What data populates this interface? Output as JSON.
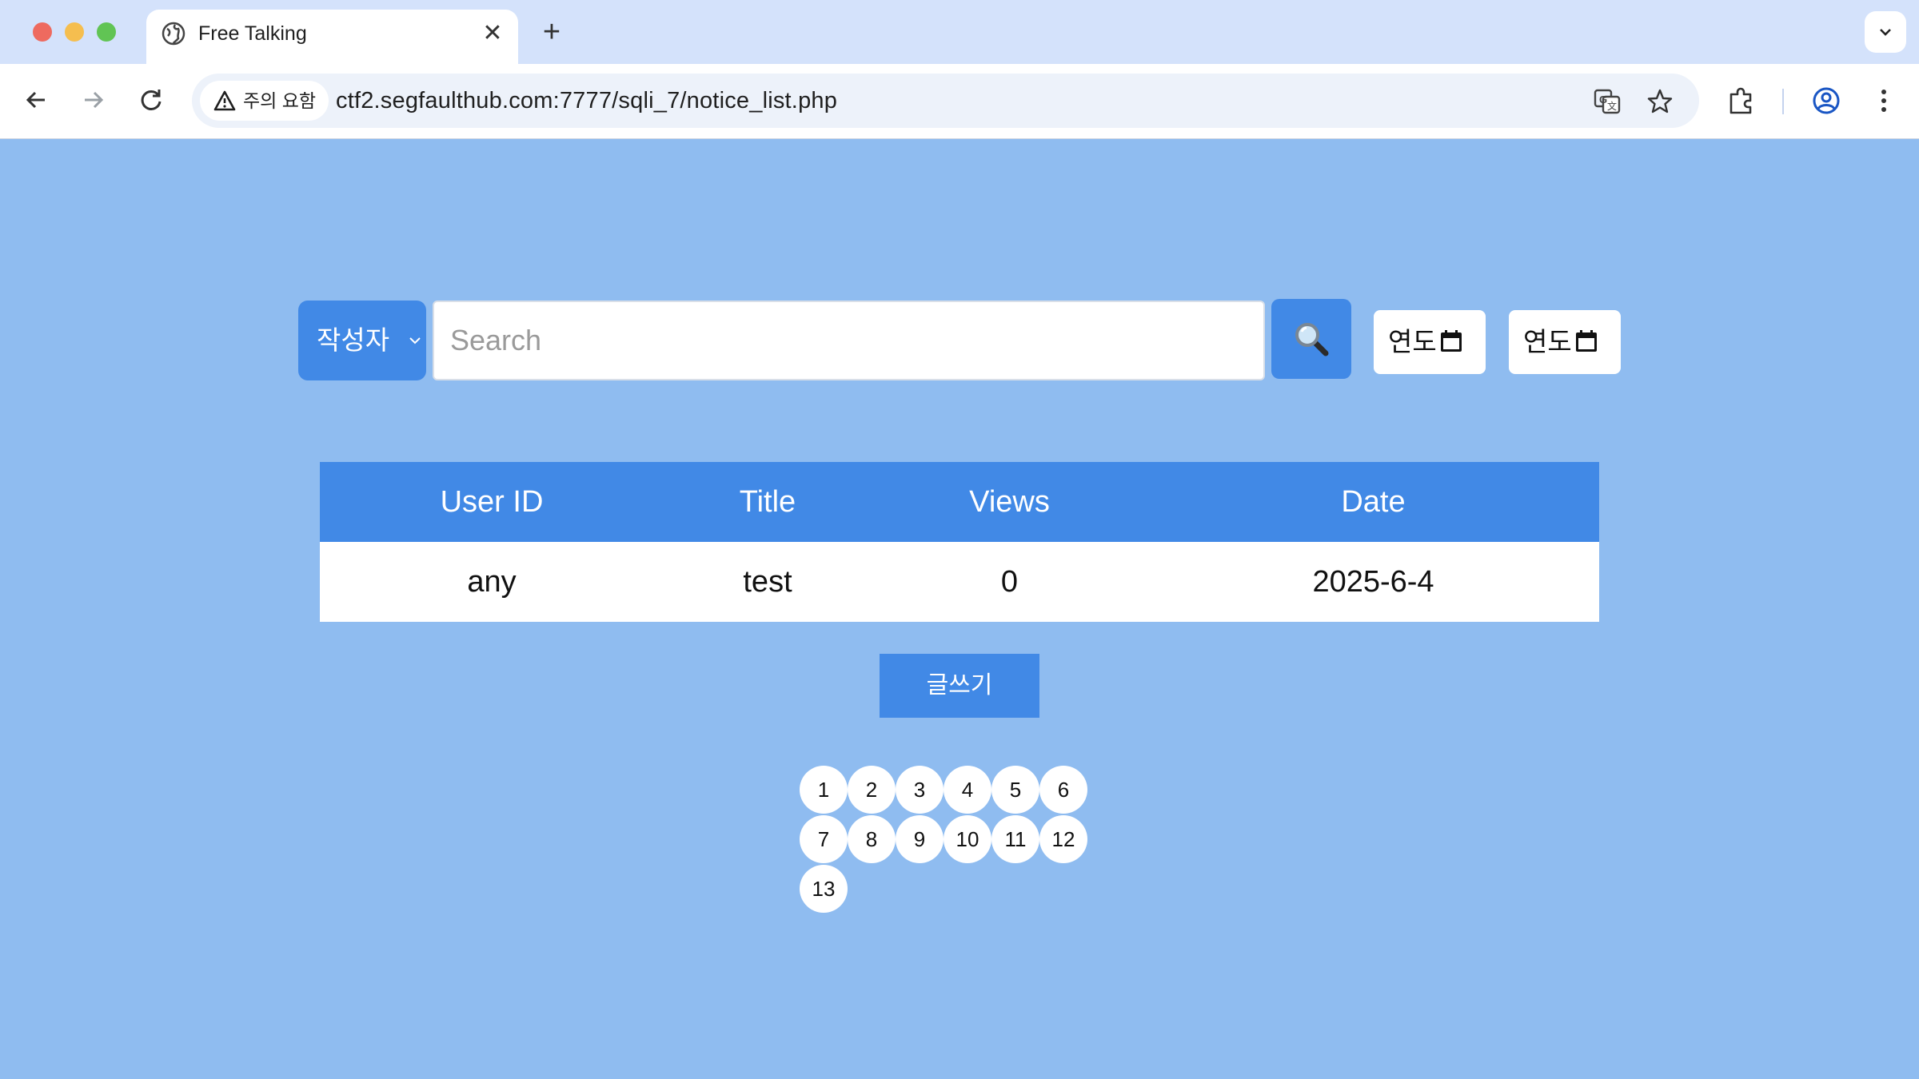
{
  "browser": {
    "tab_title": "Free Talking",
    "tab_close": "✕",
    "new_tab": "+",
    "security_label": "주의 요함",
    "url": "ctf2.segfaulthub.com:7777/sqli_7/notice_list.php"
  },
  "search": {
    "field_select": "작성자",
    "placeholder": "Search",
    "value": "",
    "year_from": "연도",
    "year_to": "연도"
  },
  "table": {
    "headers": [
      "User ID",
      "Title",
      "Views",
      "Date"
    ],
    "rows": [
      [
        "any",
        "test",
        "0",
        "2025-6-4"
      ]
    ]
  },
  "write_button": "글쓰기",
  "pagination": [
    "1",
    "2",
    "3",
    "4",
    "5",
    "6",
    "7",
    "8",
    "9",
    "10",
    "11",
    "12",
    "13"
  ],
  "colors": {
    "page_bg": "#8fbcf0",
    "accent": "#4189e6",
    "tab_strip": "#d4e2fb"
  }
}
